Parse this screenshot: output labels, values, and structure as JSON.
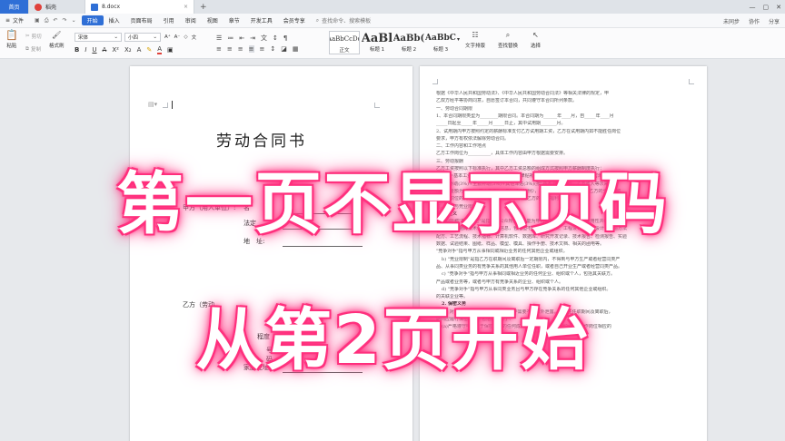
{
  "titlebar": {
    "tabs": [
      {
        "label": "首页",
        "kind": "home"
      },
      {
        "label": "稻壳",
        "kind": "doc",
        "color": "#e0413a"
      },
      {
        "label": "8.docx",
        "kind": "file",
        "color": "#2f6fd6"
      }
    ],
    "close_glyph": "×",
    "plus_glyph": "+"
  },
  "menubar": {
    "file_label": "文件",
    "items": [
      "开始",
      "插入",
      "页面布局",
      "引用",
      "审阅",
      "视图",
      "章节",
      "开发工具",
      "会员专享"
    ],
    "active_index": 0,
    "search_placeholder": "查找命令、搜索模板",
    "right_items": [
      "未同步",
      "协作",
      "分享"
    ]
  },
  "toolbar": {
    "paste_label": "粘贴",
    "cut_label": "剪切",
    "copy_label": "复制",
    "format_painter_label": "格式刷",
    "font_name": "宋体",
    "font_size": "小四",
    "styles": [
      {
        "sample": "AaBbCcDd",
        "label": "正文"
      },
      {
        "sample": "AaBl",
        "label": "标题 1"
      },
      {
        "sample": "AaBb(",
        "label": "标题 2"
      },
      {
        "sample": "AaBbC",
        "label": "标题 3"
      }
    ],
    "text_layout_label": "文字排版",
    "find_replace_label": "查找替换",
    "select_label": "选择"
  },
  "document": {
    "left_page": {
      "title": "劳动合同书",
      "party_a_label": "甲方（用人单位）:",
      "name_label": "名",
      "legal_rep_label": "法定",
      "address_label": "地　址:",
      "party_b_label": "乙方（劳动",
      "b_label_1": "别",
      "b_label_2": "程度",
      "b_label_3": "号",
      "b_label_4": "码",
      "home_address_label": "家庭住址:"
    },
    "right_page": {
      "lines": [
        {
          "text": "根据《中华人民共和国劳动法》、《中华人民共和国劳动合同法》等相关法律的规定，甲",
          "bold": false
        },
        {
          "text": "乙双方经平等协商同意，自愿签订本合同，共同遵守本合同所列条款。",
          "bold": false
        },
        {
          "text": "一、劳动合同期限",
          "bold": false
        },
        {
          "text": "1、本合同期限类型为________期限合同。本合同期为______年____月，自_____年____月",
          "bold": false
        },
        {
          "text": "_____日起至_____年_____月_____日止，其中试用期_______月。",
          "bold": false
        },
        {
          "text": "2、试用期内甲方按照约定的薪酬标准支付乙方试用期工资，乙方在试用期内如不能胜任岗位",
          "bold": false
        },
        {
          "text": "要求，甲方有权依法解除劳动合同。",
          "bold": false
        },
        {
          "text": "二、工作内容和工作地点",
          "bold": false
        },
        {
          "text": "乙方工作岗位为__________，具体工作内容由甲方根据需要安排。",
          "bold": false
        },
        {
          "text": "三、劳动报酬",
          "bold": false
        },
        {
          "text": "乙方工资按照以下标准执行，其中乙方工资总额的组成方式按照甲方薪酬制度执行：",
          "bold": false
        },
        {
          "text": "方式入=基本工资+绩效工资(10%)+岗位津贴补助(10%)+加班工资(1%)+保密津贴(1%)",
          "bold": false
        },
        {
          "text": "+提成补助(3%)+全勤补助(3%)+其他津贴(3%)(按\"基本工资\"提升，乙方收入等次来乘",
          "bold": false
        },
        {
          "text": "项发放金额为《收入-基本工资》+各项所占比例），甲方有权根据考核结果，乙方的全部工资",
          "bold": false
        },
        {
          "text": "及乙方职位的变化，依据公司工资制度，调整乙方的薪酬福利待遇。",
          "bold": false
        },
        {
          "text": "五、保密与竞业限制",
          "bold": false
        },
        {
          "text": "1. 定义",
          "bold": true
        },
        {
          "text": "本合同所称\"商业秘密\"是指不为公众所知悉，能为甲方带来经济利益，具有实用性并经甲方",
          "bold": false
        },
        {
          "text": "采取保密措施的技术信息和经营信息，包括但不限于技术方案、工程设计、电路设计、制造方法",
          "bold": false
        },
        {
          "text": "配方、工艺流程、技术指标、计算机软件、数据库、研究开发记录、技术报告、检测报告、实验",
          "bold": false
        },
        {
          "text": "数据、试验结果、图纸、样品、模型、模具、操作手册、技术文档、相关的函电等。",
          "bold": false
        },
        {
          "text": "\"竞争对手\"指与甲方从事相同或相近业务的任何其他企业或组织。",
          "bold": false
        },
        {
          "text": "b) \"竞业限制\"是指乙方在职期间及离职后一定期限内，不得到与甲方生产或者经营同类产",
          "bold": false
        },
        {
          "text": "品、从事同类业务的有竞争关系的其他用人单位任职，或者自己开业生产或者经营同类产品。",
          "bold": false
        },
        {
          "text": "c) \"竞争对手\"指与甲方从事相同或相近业务的任何企业、组织或个人，包括其关联方。",
          "bold": false
        },
        {
          "text": "产品或者业务等，或者与甲方有竞争关系的企业、组织或个人。",
          "bold": false
        },
        {
          "text": "d) \"竞争对手\"指与甲方从事同类业务且与甲方存在竞争关系的任何其他企业或组织。",
          "bold": false
        },
        {
          "text": "的关联企业等。",
          "bold": false
        },
        {
          "text": "2. 保密义务",
          "bold": true
        },
        {
          "text": "(1) 对甲方保密信息严格保密，非工作需要不得对外泄露，乙方在任职期间及离职后，",
          "bold": false
        },
        {
          "text": "期间应履行保密义务，包括但不限于：",
          "bold": false
        },
        {
          "text": "(a)严格遵守甲方关于保密信息的任何成文或不成文的规定，履行与其工作岗位相应的",
          "bold": false
        }
      ]
    }
  },
  "overlay": {
    "line1": "第一页不显示页码",
    "line2": "从第2页开始"
  },
  "colors": {
    "accent": "#2f6fd6",
    "glow": "#ff2a78"
  }
}
